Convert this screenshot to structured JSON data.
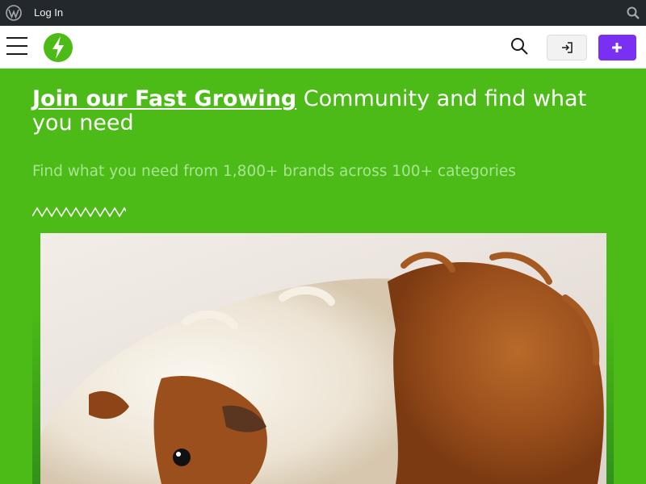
{
  "adminbar": {
    "login_label": "Log In",
    "icons": [
      "wordpress-icon",
      "search-icon"
    ]
  },
  "header": {
    "icons": [
      "menu-icon",
      "bolt-logo-icon",
      "search-icon",
      "sign-in-icon",
      "plus-icon"
    ]
  },
  "hero": {
    "title_link": "Join our Fast Growing",
    "title_rest": " Community and find what you need",
    "subtitle": "Find what you need from 1,800+ brands across 100+ categories"
  },
  "image": {
    "subject": "guinea-pig-photo"
  },
  "colors": {
    "background": "#4cbb17",
    "admin_bar": "#23282d",
    "accent_button": "#7b2ff2",
    "subtitle": "#a6e690"
  }
}
